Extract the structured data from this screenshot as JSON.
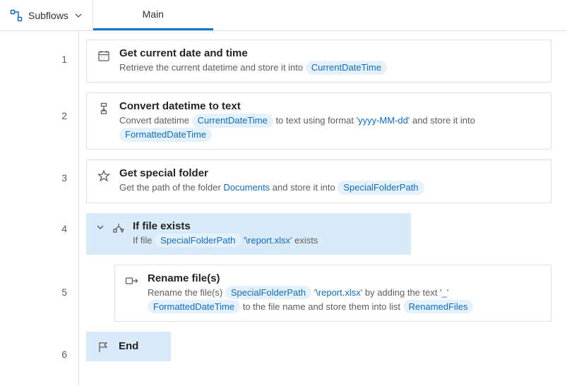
{
  "toolbar": {
    "subflows_label": "Subflows",
    "main_tab": "Main"
  },
  "lines": [
    "1",
    "2",
    "3",
    "4",
    "5",
    "6"
  ],
  "actions": {
    "a1": {
      "title": "Get current date and time",
      "pre": "Retrieve the current datetime and store it into ",
      "var": "CurrentDateTime"
    },
    "a2": {
      "title": "Convert datetime to text",
      "pre": "Convert datetime ",
      "var1": "CurrentDateTime",
      "mid": " to text using format ",
      "fmt": "yyyy-MM-dd",
      "post": " and store it into ",
      "var2": "FormattedDateTime"
    },
    "a3": {
      "title": "Get special folder",
      "pre": "Get the path of the folder ",
      "folder": "Documents",
      "mid": " and store it into ",
      "var": "SpecialFolderPath"
    },
    "a4": {
      "title": "If file exists",
      "pre": "If file ",
      "var": "SpecialFolderPath",
      "path": "\\report.xlsx",
      "post": " exists"
    },
    "a5": {
      "title": "Rename file(s)",
      "pre": "Rename the file(s) ",
      "var1": "SpecialFolderPath",
      "path": "\\report.xlsx",
      "mid": " by adding the text ",
      "underscore": "_",
      "var2": "FormattedDateTime",
      "post": " to the file name and store them into list ",
      "var3": "RenamedFiles"
    },
    "a6": {
      "title": "End"
    }
  }
}
